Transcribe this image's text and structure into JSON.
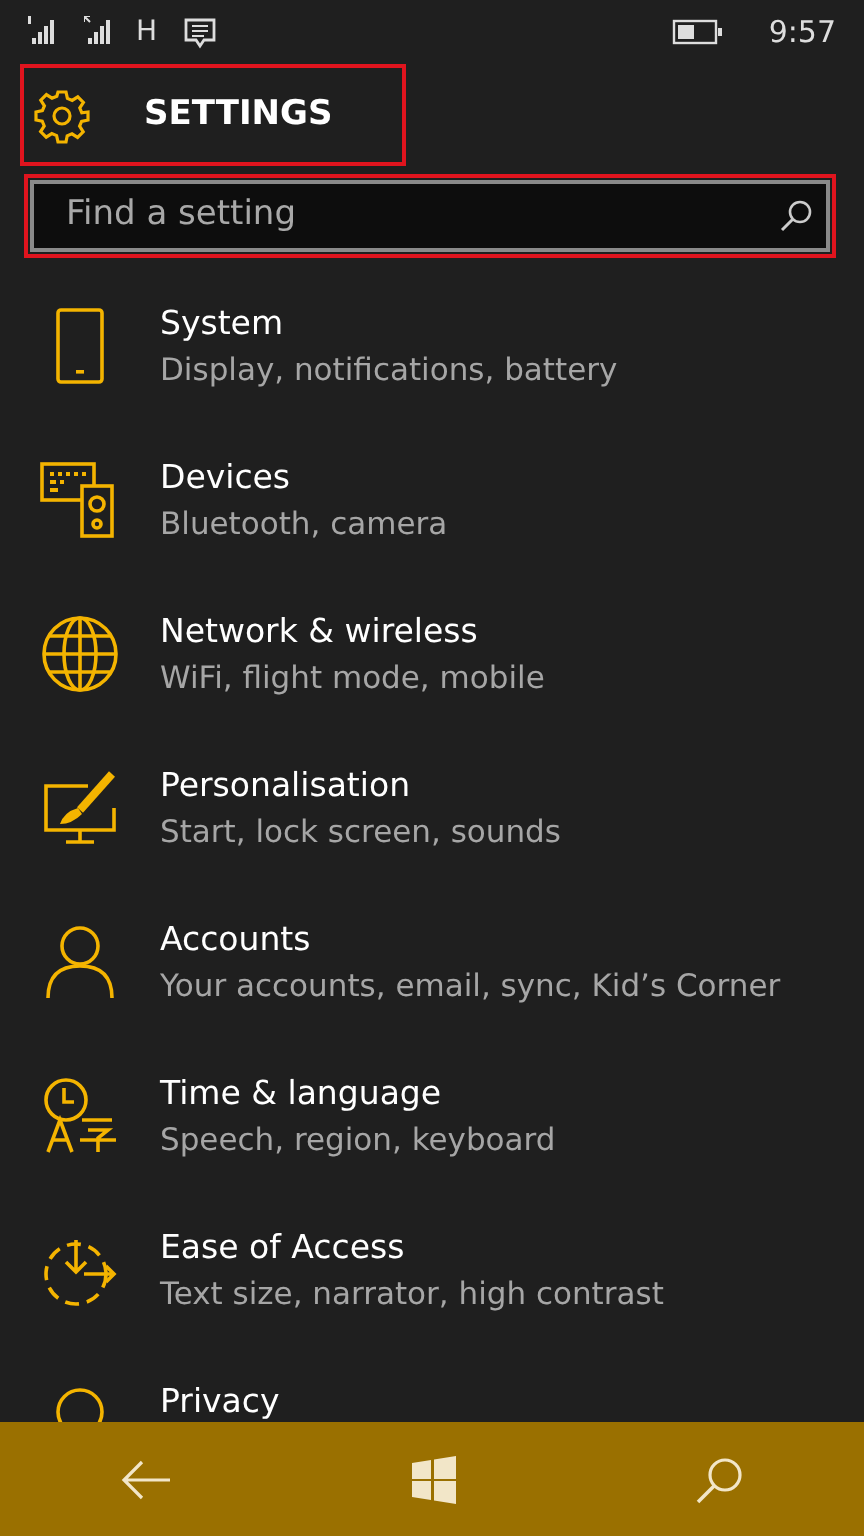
{
  "status_bar": {
    "network_type": "H",
    "time": "9:57"
  },
  "header": {
    "title": "SETTINGS"
  },
  "search": {
    "placeholder": "Find a setting"
  },
  "items": [
    {
      "title": "System",
      "subtitle": "Display, notifications, battery"
    },
    {
      "title": "Devices",
      "subtitle": "Bluetooth, camera"
    },
    {
      "title": "Network & wireless",
      "subtitle": "WiFi, flight mode, mobile"
    },
    {
      "title": "Personalisation",
      "subtitle": "Start, lock screen, sounds"
    },
    {
      "title": "Accounts",
      "subtitle": "Your accounts, email, sync, Kid’s Corner"
    },
    {
      "title": "Time & language",
      "subtitle": "Speech, region, keyboard"
    },
    {
      "title": "Ease of Access",
      "subtitle": "Text size, narrator, high contrast"
    },
    {
      "title": "Privacy"
    }
  ]
}
